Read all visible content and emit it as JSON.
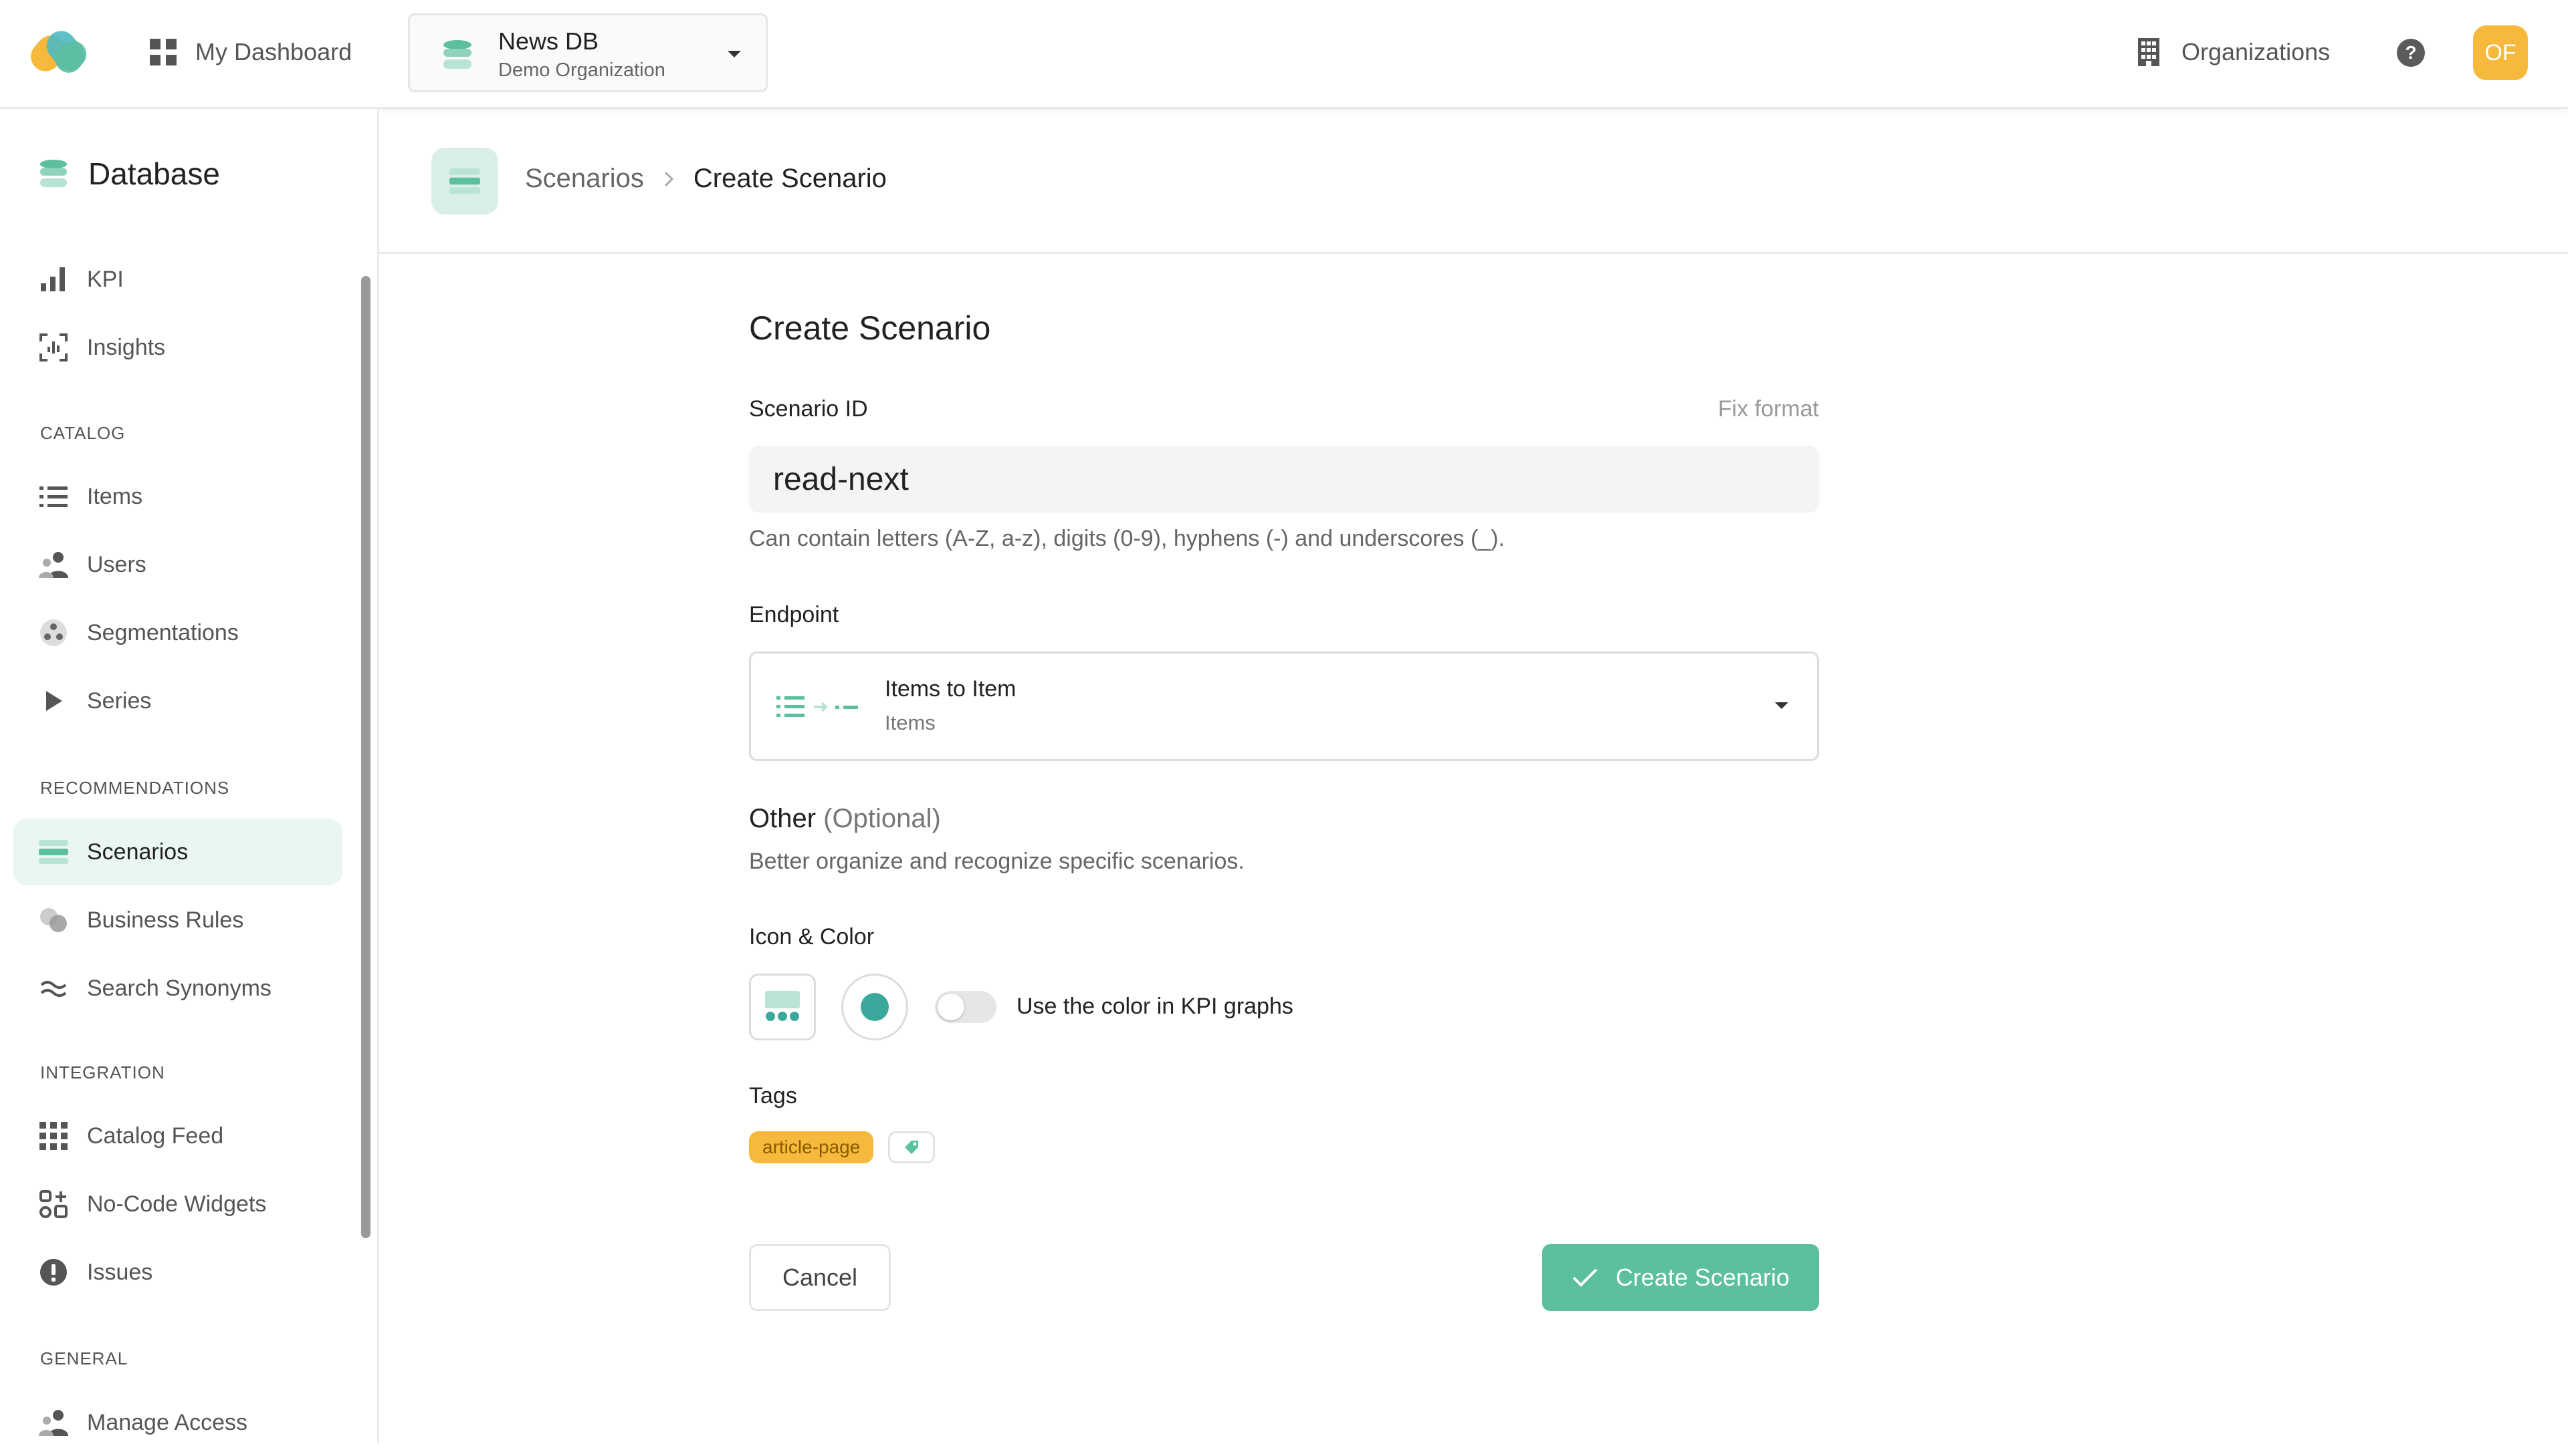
{
  "topbar": {
    "dashboard_label": "My Dashboard",
    "db_name": "News DB",
    "org_name": "Demo Organization",
    "organizations_label": "Organizations",
    "help_label": "?",
    "avatar_initials": "OF"
  },
  "sidebar": {
    "title": "Database",
    "sections": {
      "catalog": "CATALOG",
      "recommendations": "RECOMMENDATIONS",
      "integration": "INTEGRATION",
      "general": "GENERAL"
    },
    "items": {
      "kpi": "KPI",
      "insights": "Insights",
      "items": "Items",
      "users": "Users",
      "segmentations": "Segmentations",
      "series": "Series",
      "scenarios": "Scenarios",
      "business_rules": "Business Rules",
      "search_synonyms": "Search Synonyms",
      "catalog_feed": "Catalog Feed",
      "no_code_widgets": "No-Code Widgets",
      "issues": "Issues",
      "manage_access": "Manage Access"
    }
  },
  "breadcrumb": {
    "parent": "Scenarios",
    "current": "Create Scenario"
  },
  "form": {
    "title": "Create Scenario",
    "scenario_id_label": "Scenario ID",
    "fix_format_label": "Fix format",
    "scenario_id_value": "read-next",
    "scenario_id_hint": "Can contain letters (A-Z, a-z), digits (0-9), hyphens (-) and underscores (_).",
    "endpoint_label": "Endpoint",
    "endpoint_title": "Items to Item",
    "endpoint_subtitle": "Items",
    "other_label": "Other",
    "other_optional": "(Optional)",
    "other_desc": "Better organize and recognize specific scenarios.",
    "icon_color_label": "Icon & Color",
    "selected_color": "#3aa89b",
    "kpi_color_toggle_label": "Use the color in KPI graphs",
    "kpi_color_toggle_on": false,
    "tags_label": "Tags",
    "tags": [
      "article-page"
    ],
    "cancel_label": "Cancel",
    "create_label": "Create Scenario"
  },
  "colors": {
    "accent": "#5cbf9f",
    "accent_light": "#eaf6f2",
    "tag": "#f6b93b",
    "avatar": "#f6b93b"
  }
}
